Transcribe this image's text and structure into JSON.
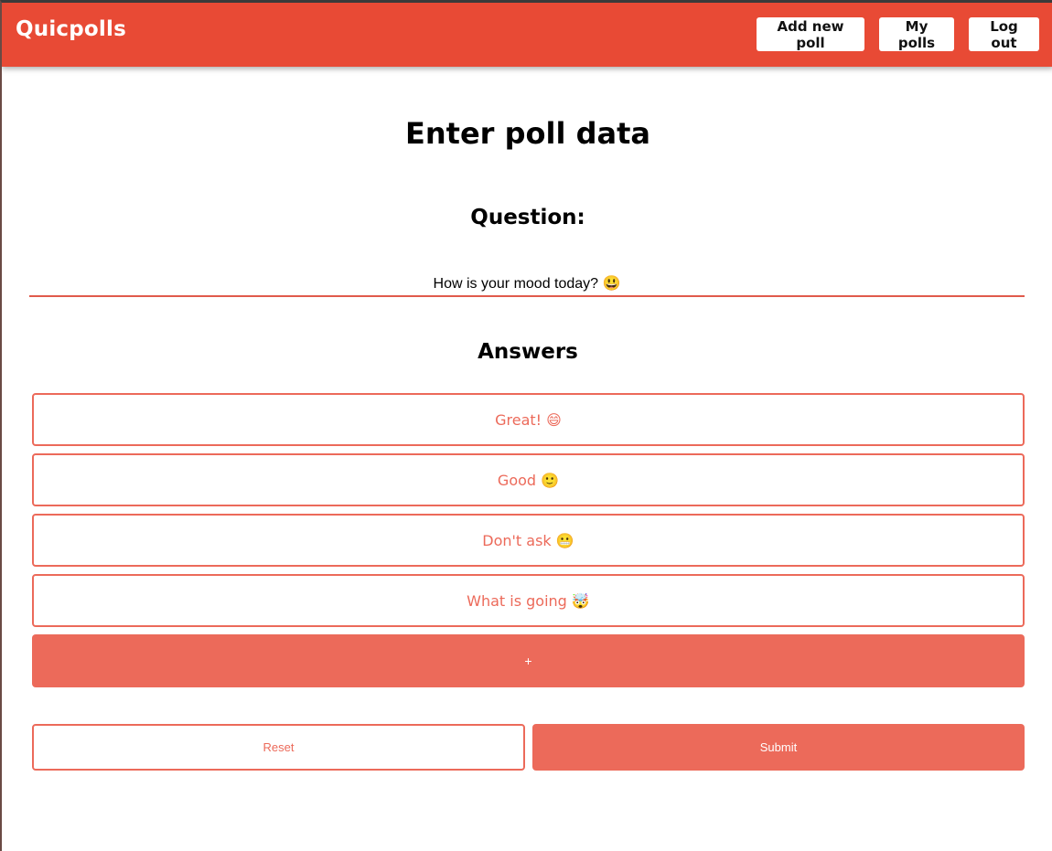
{
  "app": {
    "brand": "Quicpolls"
  },
  "nav": {
    "add_new_poll": "Add new poll",
    "my_polls": "My polls",
    "log_out": "Log out"
  },
  "form": {
    "title": "Enter poll data",
    "question_heading": "Question:",
    "question_value": "How is your mood today? 😃",
    "answers_heading": "Answers",
    "answers": [
      "Great! 😄",
      "Good 🙂",
      "Don't ask 😬",
      "What is going 🤯"
    ],
    "add_answer_label": "+",
    "reset_label": "Reset",
    "submit_label": "Submit"
  },
  "colors": {
    "navbar": "#e84a35",
    "accent": "#ec6a5a",
    "nav_button_bg": "#ffffff"
  }
}
